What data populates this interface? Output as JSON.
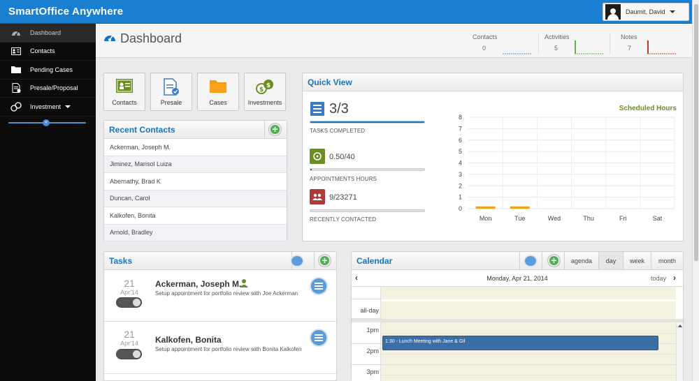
{
  "app": {
    "title": "SmartOffice Anywhere",
    "user": "Daumit, David"
  },
  "sidebar": {
    "items": [
      {
        "label": "Dashboard",
        "icon": "dashboard-icon"
      },
      {
        "label": "Contacts",
        "icon": "contacts-icon"
      },
      {
        "label": "Pending Cases",
        "icon": "folder-icon"
      },
      {
        "label": "Presale/Proposal",
        "icon": "document-check-icon"
      },
      {
        "label": "Investment",
        "icon": "coins-icon"
      }
    ],
    "collapse_glyph": "«"
  },
  "header": {
    "title": "Dashboard",
    "stats": [
      {
        "label": "Contacts",
        "value": "0"
      },
      {
        "label": "Activities",
        "value": "5"
      },
      {
        "label": "Notes",
        "value": "7"
      }
    ]
  },
  "tiles": [
    {
      "label": "Contacts",
      "icon": "contact-card-icon"
    },
    {
      "label": "Presale",
      "icon": "presale-document-icon"
    },
    {
      "label": "Cases",
      "icon": "folder-icon"
    },
    {
      "label": "Investments",
      "icon": "money-bags-icon"
    }
  ],
  "recent_contacts": {
    "title": "Recent Contacts",
    "rows": [
      "Ackerman, Joseph M.",
      "Jiminez, Marisol Luiza",
      "Abernathy, Brad K",
      "Duncan, Carol",
      "Kalkofen, Bonita",
      "Arnold, Bradley"
    ]
  },
  "quick_view": {
    "title": "Quick View",
    "tasks_value": "3/3",
    "tasks_label": "TASKS COMPLETED",
    "tasks_fraction": 1.0,
    "appt_value": "0.50/40",
    "appt_label": "APPOINTMENTS HOURS",
    "appt_fraction": 0.0125,
    "recent_value": "9/23271",
    "recent_label": "RECENTLY CONTACTED",
    "recent_fraction": 0.0004,
    "colors": {
      "tasks": "#1a73c0",
      "appointments": "#6b8e23",
      "recent": "#b03a3a"
    }
  },
  "chart_data": {
    "type": "bar",
    "title": "Scheduled Hours",
    "categories": [
      "Mon",
      "Tue",
      "Wed",
      "Thu",
      "Fri",
      "Sat"
    ],
    "values": [
      0.2,
      0.2,
      0,
      0,
      0,
      0
    ],
    "ylim": [
      0,
      8
    ],
    "yticks": [
      "0",
      "1",
      "2",
      "3",
      "4",
      "5",
      "6",
      "7",
      "8"
    ],
    "grid": true,
    "bar_color": "#e8a319"
  },
  "tasks": {
    "title": "Tasks",
    "items": [
      {
        "day": "21",
        "month": "Apr'14",
        "name": "Ackerman, Joseph M.",
        "desc": "Setup appointment for portfolio review with Joe Ackerman"
      },
      {
        "day": "21",
        "month": "Apr'14",
        "name": "Kalkofen, Bonita",
        "desc": "Setup appointment for portfolio review with Bonita Kalkofen"
      }
    ]
  },
  "calendar": {
    "title": "Calendar",
    "views": [
      "agenda",
      "day",
      "week",
      "month"
    ],
    "date": "Monday, Apr 21, 2014",
    "today": "today",
    "allday": "all-day",
    "hours": [
      "1pm",
      "2pm",
      "3pm"
    ],
    "event": "1:30 - Lunch Meeting with Jane & Gil"
  }
}
